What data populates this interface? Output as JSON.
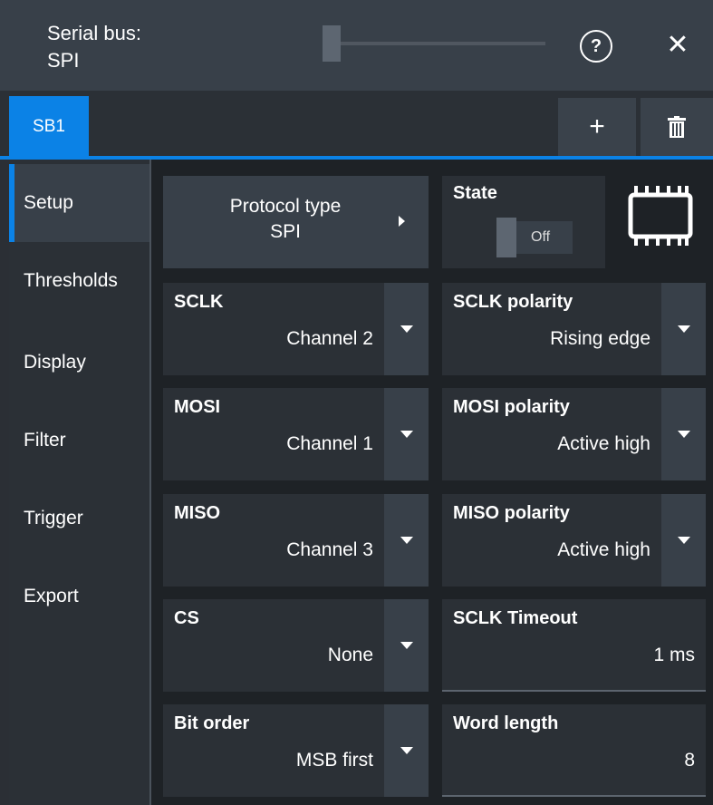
{
  "header": {
    "title_line1": "Serial bus:",
    "title_line2": "SPI",
    "help_glyph": "?",
    "close_glyph": "✕"
  },
  "tabs": {
    "active_label": "SB1",
    "add_glyph": "+",
    "icons": {
      "add": "plus-icon",
      "delete": "trash-icon"
    },
    "accent_color": "#0b82e6"
  },
  "nav": {
    "items": [
      {
        "label": "Setup",
        "active": true
      },
      {
        "label": "Thresholds",
        "active": false
      },
      {
        "label": "Display",
        "active": false
      },
      {
        "label": "Filter",
        "active": false
      },
      {
        "label": "Trigger",
        "active": false
      },
      {
        "label": "Export",
        "active": false
      }
    ]
  },
  "protocol": {
    "line1": "Protocol type",
    "line2": "SPI"
  },
  "state": {
    "label": "State",
    "value": "Off"
  },
  "fields": {
    "sclk": {
      "label": "SCLK",
      "value": "Channel 2"
    },
    "sclk_polarity": {
      "label": "SCLK polarity",
      "value": "Rising edge"
    },
    "mosi": {
      "label": "MOSI",
      "value": "Channel 1"
    },
    "mosi_polarity": {
      "label": "MOSI polarity",
      "value": "Active high"
    },
    "miso": {
      "label": "MISO",
      "value": "Channel 3"
    },
    "miso_polarity": {
      "label": "MISO polarity",
      "value": "Active high"
    },
    "cs": {
      "label": "CS",
      "value": "None"
    },
    "sclk_timeout": {
      "label": "SCLK Timeout",
      "value": "1 ms"
    },
    "bit_order": {
      "label": "Bit order",
      "value": "MSB first"
    },
    "word_length": {
      "label": "Word length",
      "value": "8"
    }
  }
}
